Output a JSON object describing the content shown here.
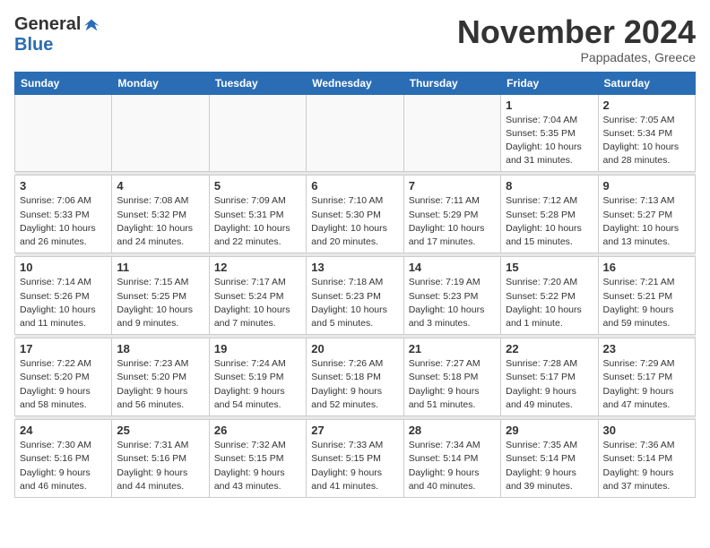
{
  "header": {
    "logo_general": "General",
    "logo_blue": "Blue",
    "month_title": "November 2024",
    "location": "Pappadates, Greece"
  },
  "days_of_week": [
    "Sunday",
    "Monday",
    "Tuesday",
    "Wednesday",
    "Thursday",
    "Friday",
    "Saturday"
  ],
  "weeks": [
    [
      {
        "day": "",
        "info": ""
      },
      {
        "day": "",
        "info": ""
      },
      {
        "day": "",
        "info": ""
      },
      {
        "day": "",
        "info": ""
      },
      {
        "day": "",
        "info": ""
      },
      {
        "day": "1",
        "info": "Sunrise: 7:04 AM\nSunset: 5:35 PM\nDaylight: 10 hours and 31 minutes."
      },
      {
        "day": "2",
        "info": "Sunrise: 7:05 AM\nSunset: 5:34 PM\nDaylight: 10 hours and 28 minutes."
      }
    ],
    [
      {
        "day": "3",
        "info": "Sunrise: 7:06 AM\nSunset: 5:33 PM\nDaylight: 10 hours and 26 minutes."
      },
      {
        "day": "4",
        "info": "Sunrise: 7:08 AM\nSunset: 5:32 PM\nDaylight: 10 hours and 24 minutes."
      },
      {
        "day": "5",
        "info": "Sunrise: 7:09 AM\nSunset: 5:31 PM\nDaylight: 10 hours and 22 minutes."
      },
      {
        "day": "6",
        "info": "Sunrise: 7:10 AM\nSunset: 5:30 PM\nDaylight: 10 hours and 20 minutes."
      },
      {
        "day": "7",
        "info": "Sunrise: 7:11 AM\nSunset: 5:29 PM\nDaylight: 10 hours and 17 minutes."
      },
      {
        "day": "8",
        "info": "Sunrise: 7:12 AM\nSunset: 5:28 PM\nDaylight: 10 hours and 15 minutes."
      },
      {
        "day": "9",
        "info": "Sunrise: 7:13 AM\nSunset: 5:27 PM\nDaylight: 10 hours and 13 minutes."
      }
    ],
    [
      {
        "day": "10",
        "info": "Sunrise: 7:14 AM\nSunset: 5:26 PM\nDaylight: 10 hours and 11 minutes."
      },
      {
        "day": "11",
        "info": "Sunrise: 7:15 AM\nSunset: 5:25 PM\nDaylight: 10 hours and 9 minutes."
      },
      {
        "day": "12",
        "info": "Sunrise: 7:17 AM\nSunset: 5:24 PM\nDaylight: 10 hours and 7 minutes."
      },
      {
        "day": "13",
        "info": "Sunrise: 7:18 AM\nSunset: 5:23 PM\nDaylight: 10 hours and 5 minutes."
      },
      {
        "day": "14",
        "info": "Sunrise: 7:19 AM\nSunset: 5:23 PM\nDaylight: 10 hours and 3 minutes."
      },
      {
        "day": "15",
        "info": "Sunrise: 7:20 AM\nSunset: 5:22 PM\nDaylight: 10 hours and 1 minute."
      },
      {
        "day": "16",
        "info": "Sunrise: 7:21 AM\nSunset: 5:21 PM\nDaylight: 9 hours and 59 minutes."
      }
    ],
    [
      {
        "day": "17",
        "info": "Sunrise: 7:22 AM\nSunset: 5:20 PM\nDaylight: 9 hours and 58 minutes."
      },
      {
        "day": "18",
        "info": "Sunrise: 7:23 AM\nSunset: 5:20 PM\nDaylight: 9 hours and 56 minutes."
      },
      {
        "day": "19",
        "info": "Sunrise: 7:24 AM\nSunset: 5:19 PM\nDaylight: 9 hours and 54 minutes."
      },
      {
        "day": "20",
        "info": "Sunrise: 7:26 AM\nSunset: 5:18 PM\nDaylight: 9 hours and 52 minutes."
      },
      {
        "day": "21",
        "info": "Sunrise: 7:27 AM\nSunset: 5:18 PM\nDaylight: 9 hours and 51 minutes."
      },
      {
        "day": "22",
        "info": "Sunrise: 7:28 AM\nSunset: 5:17 PM\nDaylight: 9 hours and 49 minutes."
      },
      {
        "day": "23",
        "info": "Sunrise: 7:29 AM\nSunset: 5:17 PM\nDaylight: 9 hours and 47 minutes."
      }
    ],
    [
      {
        "day": "24",
        "info": "Sunrise: 7:30 AM\nSunset: 5:16 PM\nDaylight: 9 hours and 46 minutes."
      },
      {
        "day": "25",
        "info": "Sunrise: 7:31 AM\nSunset: 5:16 PM\nDaylight: 9 hours and 44 minutes."
      },
      {
        "day": "26",
        "info": "Sunrise: 7:32 AM\nSunset: 5:15 PM\nDaylight: 9 hours and 43 minutes."
      },
      {
        "day": "27",
        "info": "Sunrise: 7:33 AM\nSunset: 5:15 PM\nDaylight: 9 hours and 41 minutes."
      },
      {
        "day": "28",
        "info": "Sunrise: 7:34 AM\nSunset: 5:14 PM\nDaylight: 9 hours and 40 minutes."
      },
      {
        "day": "29",
        "info": "Sunrise: 7:35 AM\nSunset: 5:14 PM\nDaylight: 9 hours and 39 minutes."
      },
      {
        "day": "30",
        "info": "Sunrise: 7:36 AM\nSunset: 5:14 PM\nDaylight: 9 hours and 37 minutes."
      }
    ]
  ]
}
